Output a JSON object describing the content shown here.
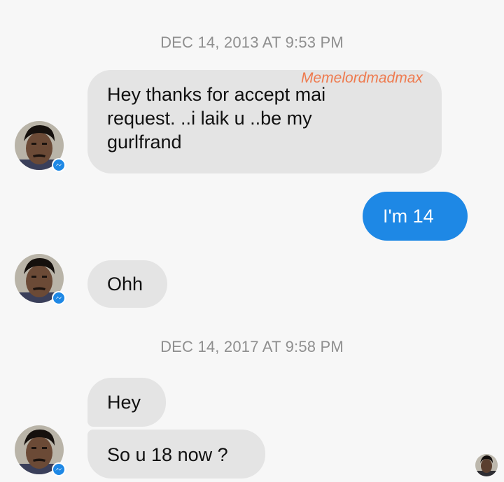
{
  "conversation": {
    "timestamps": [
      "DEC 14, 2013 AT 9:53 PM",
      "DEC 14, 2017 AT 9:58 PM"
    ],
    "watermark": "Memelordmadmax",
    "messages": [
      {
        "side": "incoming",
        "lines": [
          "Hey thanks for accept mai",
          "request. ..i laik u ..be my",
          "gurlfrand"
        ]
      },
      {
        "side": "outgoing",
        "text": "I'm 14"
      },
      {
        "side": "incoming",
        "text": "Ohh"
      },
      {
        "side": "incoming",
        "text": "Hey"
      },
      {
        "side": "incoming",
        "text": "So u 18 now ?"
      }
    ]
  },
  "colors": {
    "background": "#f7f7f7",
    "incoming_bubble": "#e4e4e4",
    "outgoing_bubble": "#1e88e5",
    "timestamp_text": "#8f8f8f",
    "watermark_text": "#ee7a4e",
    "messenger_badge": "#1e88e5"
  },
  "icons": {
    "avatar": "contact-avatar-icon",
    "badge": "messenger-badge-icon",
    "read_receipt": "read-receipt-avatar-icon"
  }
}
